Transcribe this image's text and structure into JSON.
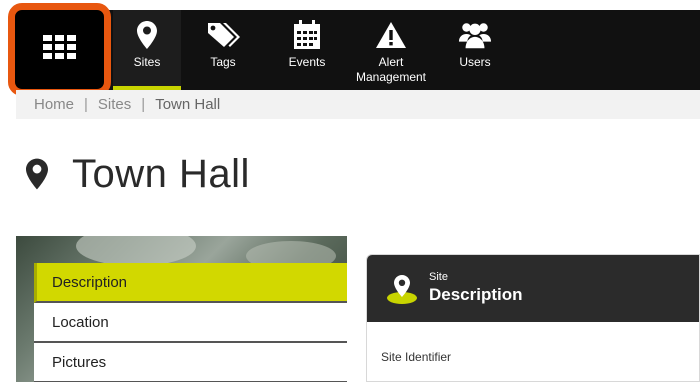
{
  "nav": {
    "items": [
      {
        "label": "Sites",
        "icon": "map-pin-icon"
      },
      {
        "label": "Tags",
        "icon": "tags-icon"
      },
      {
        "label": "Events",
        "icon": "calendar-icon"
      },
      {
        "label": "Alert Management",
        "icon": "warning-icon"
      },
      {
        "label": "Users",
        "icon": "users-icon"
      }
    ],
    "apps_icon": "apps-grid-icon",
    "accent_color": "#c8d400",
    "highlight_color": "#e8570f"
  },
  "breadcrumb": {
    "items": [
      "Home",
      "Sites",
      "Town Hall"
    ]
  },
  "page": {
    "title": "Town Hall"
  },
  "side_menu": {
    "items": [
      "Description",
      "Location",
      "Pictures"
    ],
    "active": "Description"
  },
  "card": {
    "subtitle": "Site",
    "title": "Description",
    "field_label": "Site Identifier"
  }
}
